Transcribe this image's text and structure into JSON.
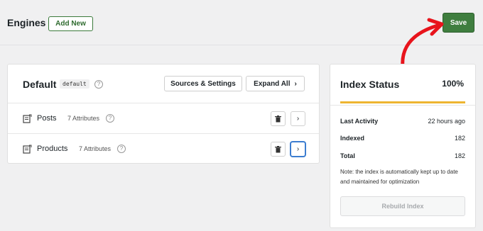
{
  "header": {
    "title": "Engines",
    "add_new_label": "Add New",
    "save_label": "Save"
  },
  "engine": {
    "name": "Default",
    "badge": "default",
    "help_glyph": "?",
    "sources_label": "Sources & Settings",
    "expand_label": "Expand All",
    "rows": [
      {
        "name": "Posts",
        "attributes": "7 Attributes"
      },
      {
        "name": "Products",
        "attributes": "7 Attributes"
      }
    ]
  },
  "index_status": {
    "title": "Index Status",
    "percent": "100%",
    "progress": 1.0,
    "last_activity_label": "Last Activity",
    "last_activity_value": "22 hours ago",
    "indexed_label": "Indexed",
    "indexed_value": "182",
    "total_label": "Total",
    "total_value": "182",
    "note": "Note: the index is automatically kept up to date and maintained for optimization",
    "rebuild_label": "Rebuild Index"
  },
  "colors": {
    "accent_green": "#3f7e3f",
    "progress_orange": "#eeb531",
    "annotation_red": "#e8141c",
    "focus_blue": "#3c7dd0"
  }
}
